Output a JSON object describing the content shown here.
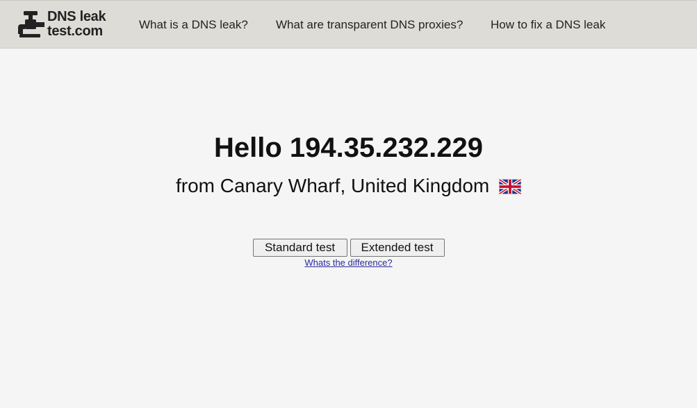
{
  "header": {
    "logo": {
      "line1": "DNS leak",
      "line2": "test.com",
      "icon": "faucet-icon"
    },
    "nav": [
      {
        "label": "What is a DNS leak?"
      },
      {
        "label": "What are transparent DNS proxies?"
      },
      {
        "label": "How to fix a DNS leak"
      }
    ]
  },
  "main": {
    "greeting": "Hello 194.35.232.229",
    "location": "from Canary Wharf, United Kingdom",
    "flag_icon": "uk-flag-icon",
    "buttons": {
      "standard": "Standard test",
      "extended": "Extended test"
    },
    "difference_link": "Whats the difference?"
  },
  "colors": {
    "header_bg": "#dddcd7",
    "page_bg": "#f5f5f5",
    "link": "#2a2a9e"
  }
}
